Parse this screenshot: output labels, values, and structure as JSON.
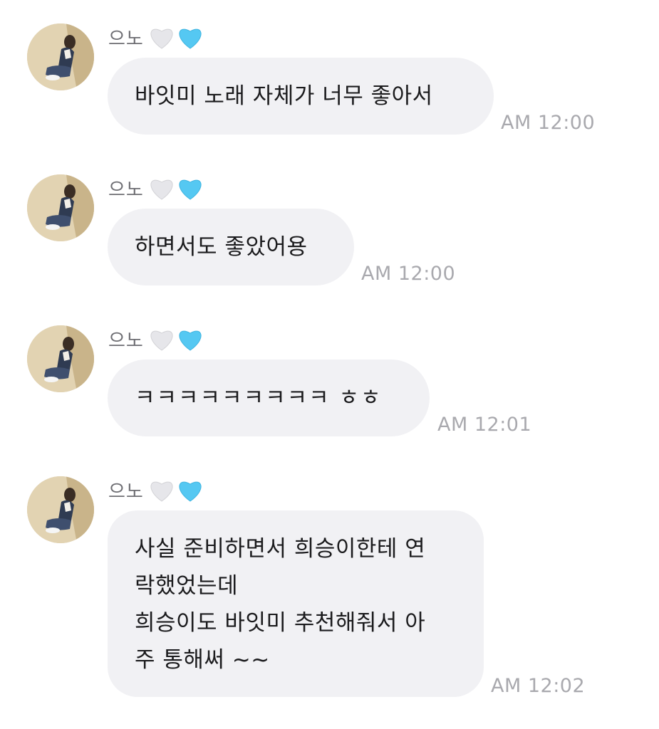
{
  "colors": {
    "bubble": "#f1f1f4",
    "text": "#1b1b1d",
    "timestamp": "#a9a9ae",
    "sender": "#6e6e73",
    "heart_white": "#e6e6ea",
    "heart_blue": "#55c8f2"
  },
  "messages": [
    {
      "sender": "으노",
      "icons": [
        "white-heart-icon",
        "blue-heart-icon"
      ],
      "text": "바잇미 노래 자체가 너무 좋아서",
      "time": "AM 12:00"
    },
    {
      "sender": "으노",
      "icons": [
        "white-heart-icon",
        "blue-heart-icon"
      ],
      "text": "하면서도 좋았어용",
      "time": "AM 12:00"
    },
    {
      "sender": "으노",
      "icons": [
        "white-heart-icon",
        "blue-heart-icon"
      ],
      "text": "ㅋㅋㅋㅋㅋㅋㅋㅋㅋ ㅎㅎ",
      "time": "AM 12:01"
    },
    {
      "sender": "으노",
      "icons": [
        "white-heart-icon",
        "blue-heart-icon"
      ],
      "text": "사실 준비하면서 희승이한테 연\n락했었는데\n희승이도 바잇미 추천해줘서 아\n주 통해써 ~~",
      "time": "AM 12:02"
    }
  ]
}
